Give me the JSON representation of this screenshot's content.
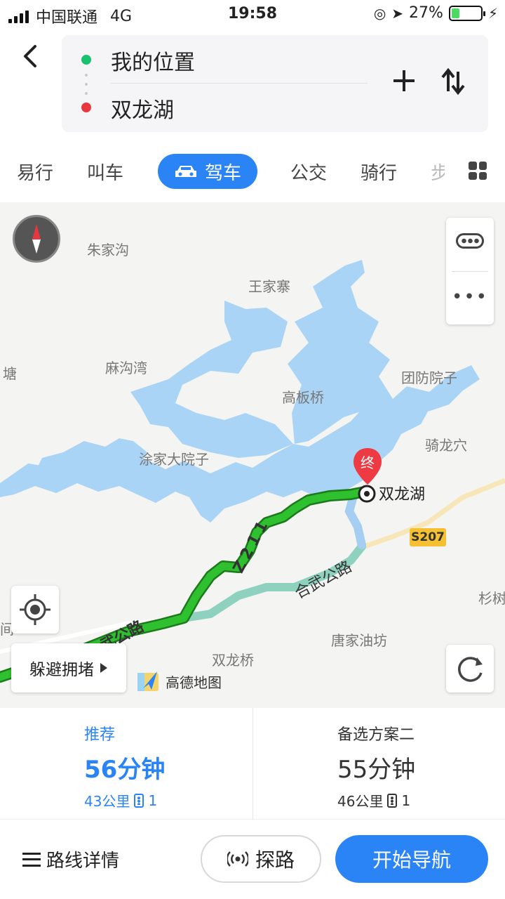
{
  "status": {
    "carrier": "中国联通",
    "network": "4G",
    "time": "19:58",
    "battery_percent": "27%",
    "battery_level": 0.27
  },
  "route": {
    "from": "我的位置",
    "to": "双龙湖"
  },
  "tabs": [
    "易行",
    "叫车",
    "驾车",
    "公交",
    "骑行",
    "步"
  ],
  "active_tab": "驾车",
  "map": {
    "places": [
      "朱家沟",
      "王家寨",
      "塘",
      "麻沟湾",
      "团防院子",
      "高板桥",
      "骑龙穴",
      "涂家大院子",
      "杉树",
      "间",
      "唐家油坊",
      "双龙桥"
    ],
    "destination_marker": "终",
    "destination_label": "双龙湖",
    "road_shield": "S207",
    "road_name_1": "合武公路",
    "road_name_2": "Z211",
    "road_name_3": "武公路",
    "avoid_label": "躲避拥堵",
    "brand": "高德地图",
    "colors": {
      "water": "#a9d4f5",
      "route": "#1ea81e",
      "alt_route": "#8fd1bf",
      "accent": "#2b84f6"
    }
  },
  "options": {
    "recommended": {
      "tag": "推荐",
      "time": "56分钟",
      "distance": "43公里",
      "lights": "1"
    },
    "alternative": {
      "tag": "备选方案二",
      "time": "55分钟",
      "distance": "46公里",
      "lights": "1"
    }
  },
  "bottom": {
    "details": "路线详情",
    "explore": "探路",
    "navigate": "开始导航"
  }
}
